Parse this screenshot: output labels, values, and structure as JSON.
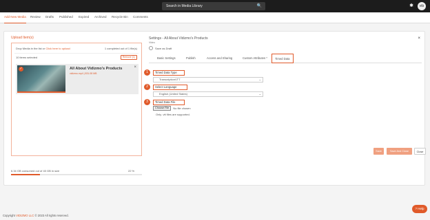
{
  "header": {
    "search_placeholder": "Search in Media Library",
    "avatar_initials": "vtb"
  },
  "tabs": [
    {
      "label": "Add New Media"
    },
    {
      "label": "Review"
    },
    {
      "label": "Drafts"
    },
    {
      "label": "Published"
    },
    {
      "label": "Expired"
    },
    {
      "label": "Archived"
    },
    {
      "label": "Recycle Bin"
    },
    {
      "label": "Comments"
    }
  ],
  "upload": {
    "title": "Upload Item(s)",
    "drop_prefix": "Drop Media in the list or ",
    "drop_link": "Click here to upload",
    "completed": "1 completed out of 1 file(s)",
    "selected": "10 items selected",
    "remove_label": "Remove (1)",
    "item_title": "All About Vidizmo's Products",
    "item_size": "vidizmo.mp4 | 831.08 MB",
    "storage_text": "6.34 GB consumed out of 40 GB in size",
    "storage_pct": "22 %",
    "storage_fraction": 0.22
  },
  "settings": {
    "title": "Settings - All About Vidizmo's Products",
    "type": "Video",
    "draft_label": "Save as Draft",
    "tabs": [
      {
        "label": "Basic Settings"
      },
      {
        "label": "Publish"
      },
      {
        "label": "Access and Sharing"
      },
      {
        "label": "Custom Attributes *"
      },
      {
        "label": "Timed Data"
      }
    ],
    "fields": [
      {
        "badge": "1",
        "label": "Timed Data Type",
        "value": "TranscriptionVTT"
      },
      {
        "badge": "2",
        "label": "Select Language",
        "value": "English (United States)"
      },
      {
        "badge": "3",
        "label": "Timed Data File"
      }
    ],
    "choose_label": "Choose File",
    "no_file": "No file chosen",
    "hint": "Only .vtt files are supported."
  },
  "buttons": {
    "save": "Save",
    "save_next": "Save And Close",
    "close": "Close"
  },
  "footer": {
    "prefix": "Copyright ",
    "brand": "VIDIZMO LLC",
    "suffix": " © 2023 All rights reserved."
  },
  "help_label": "Help",
  "colors": {
    "accent": "#e05a2a",
    "topbar": "#1c1c1c"
  }
}
